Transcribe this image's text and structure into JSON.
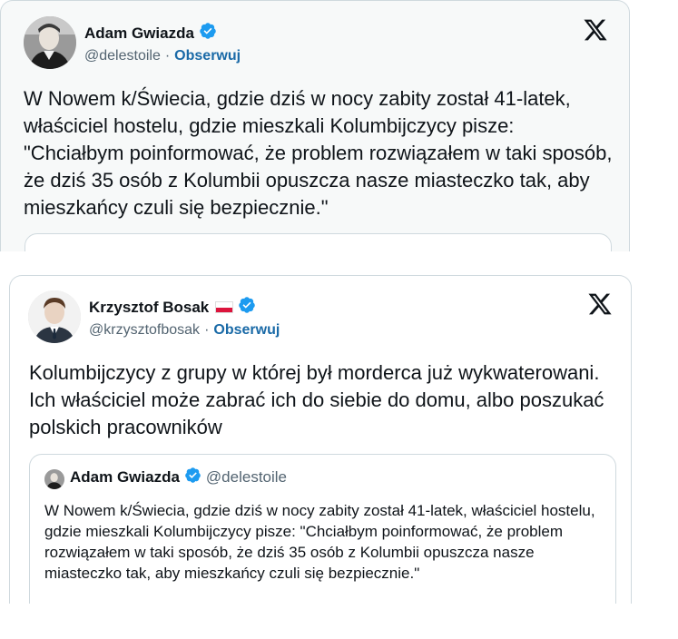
{
  "tweet1": {
    "author_name": "Adam Gwiazda",
    "handle": "@delestoile",
    "separator": "·",
    "follow_label": "Obserwuj",
    "text": "W Nowem k/Świecia, gdzie dziś w nocy zabity został 41-latek, właściciel hostelu, gdzie mieszkali Kolumbijczycy pisze: \"Chciałbym poinformować, że problem rozwiązałem w taki sposób, że dziś 35 osób z Kolumbii opuszcza nasze miasteczko tak, aby mieszkańcy czuli się bezpiecznie.\""
  },
  "tweet2": {
    "author_name": "Krzysztof Bosak",
    "handle": "@krzysztofbosak",
    "separator": "·",
    "follow_label": "Obserwuj",
    "text": "Kolumbijczycy z grupy w której był morderca już wykwaterowani. Ich właściciel może zabrać ich do siebie do domu, albo poszukać polskich pracowników",
    "quote": {
      "author_name": "Adam Gwiazda",
      "handle": "@delestoile",
      "text": "W Nowem k/Świecia, gdzie dziś w nocy zabity został 41-latek, właściciel hostelu, gdzie mieszkali Kolumbijczycy pisze: \"Chciałbym poinformować, że problem rozwiązałem w taki sposób, że dziś 35 osób z Kolumbii opuszcza nasze miasteczko tak, aby mieszkańcy czuli się bezpiecznie.\""
    }
  },
  "icons": {
    "verified": "verified-badge-icon",
    "x_logo": "x-logo-icon",
    "flag": "poland-flag-icon"
  },
  "colors": {
    "verified_blue": "#1d9bf0",
    "follow_blue": "#1d9bf0",
    "text": "#0f1419",
    "secondary_text": "#536471",
    "border": "#cfd9de"
  }
}
